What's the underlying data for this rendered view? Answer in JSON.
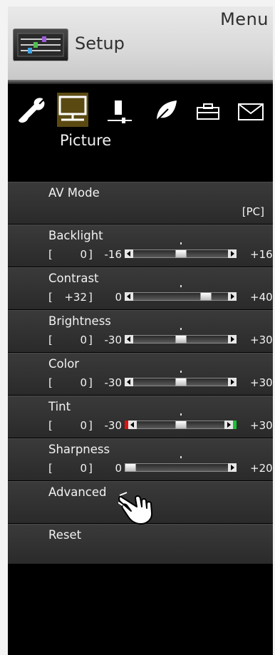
{
  "header": {
    "menu_title": "Menu",
    "section_title": "Setup"
  },
  "categories": {
    "icons": [
      "wrench-icon",
      "picture-monitor-icon",
      "speaker-icon",
      "eco-leaf-icon",
      "toolbox-icon",
      "envelope-icon"
    ],
    "selected": "Picture"
  },
  "menu": {
    "av_mode": {
      "label": "AV Mode",
      "value": "[PC]"
    },
    "backlight": {
      "label": "Backlight",
      "bracket_open": "[",
      "current": "0",
      "bracket_close": "]",
      "min": "-16",
      "max": "+16",
      "level": 0.5
    },
    "contrast": {
      "label": "Contrast",
      "bracket_open": "[",
      "current": "+32",
      "bracket_close": "]",
      "min": "0",
      "max": "+40",
      "level": 0.8
    },
    "brightness": {
      "label": "Brightness",
      "bracket_open": "[",
      "current": "0",
      "bracket_close": "]",
      "min": "-30",
      "max": "+30",
      "level": 0.5
    },
    "color": {
      "label": "Color",
      "bracket_open": "[",
      "current": "0",
      "bracket_close": "]",
      "min": "-30",
      "max": "+30",
      "level": 0.5
    },
    "tint": {
      "label": "Tint",
      "bracket_open": "[",
      "current": "0",
      "bracket_close": "]",
      "min": "-30",
      "max": "+30",
      "level": 0.5
    },
    "sharpness": {
      "label": "Sharpness",
      "bracket_open": "[",
      "current": "0",
      "bracket_close": "]",
      "min": "0",
      "max": "+20",
      "level": 0.0
    },
    "advanced": {
      "label": "Advanced"
    },
    "reset": {
      "label": "Reset"
    }
  },
  "colors": {
    "tint_left": "#e01010",
    "tint_right": "#19c430"
  }
}
